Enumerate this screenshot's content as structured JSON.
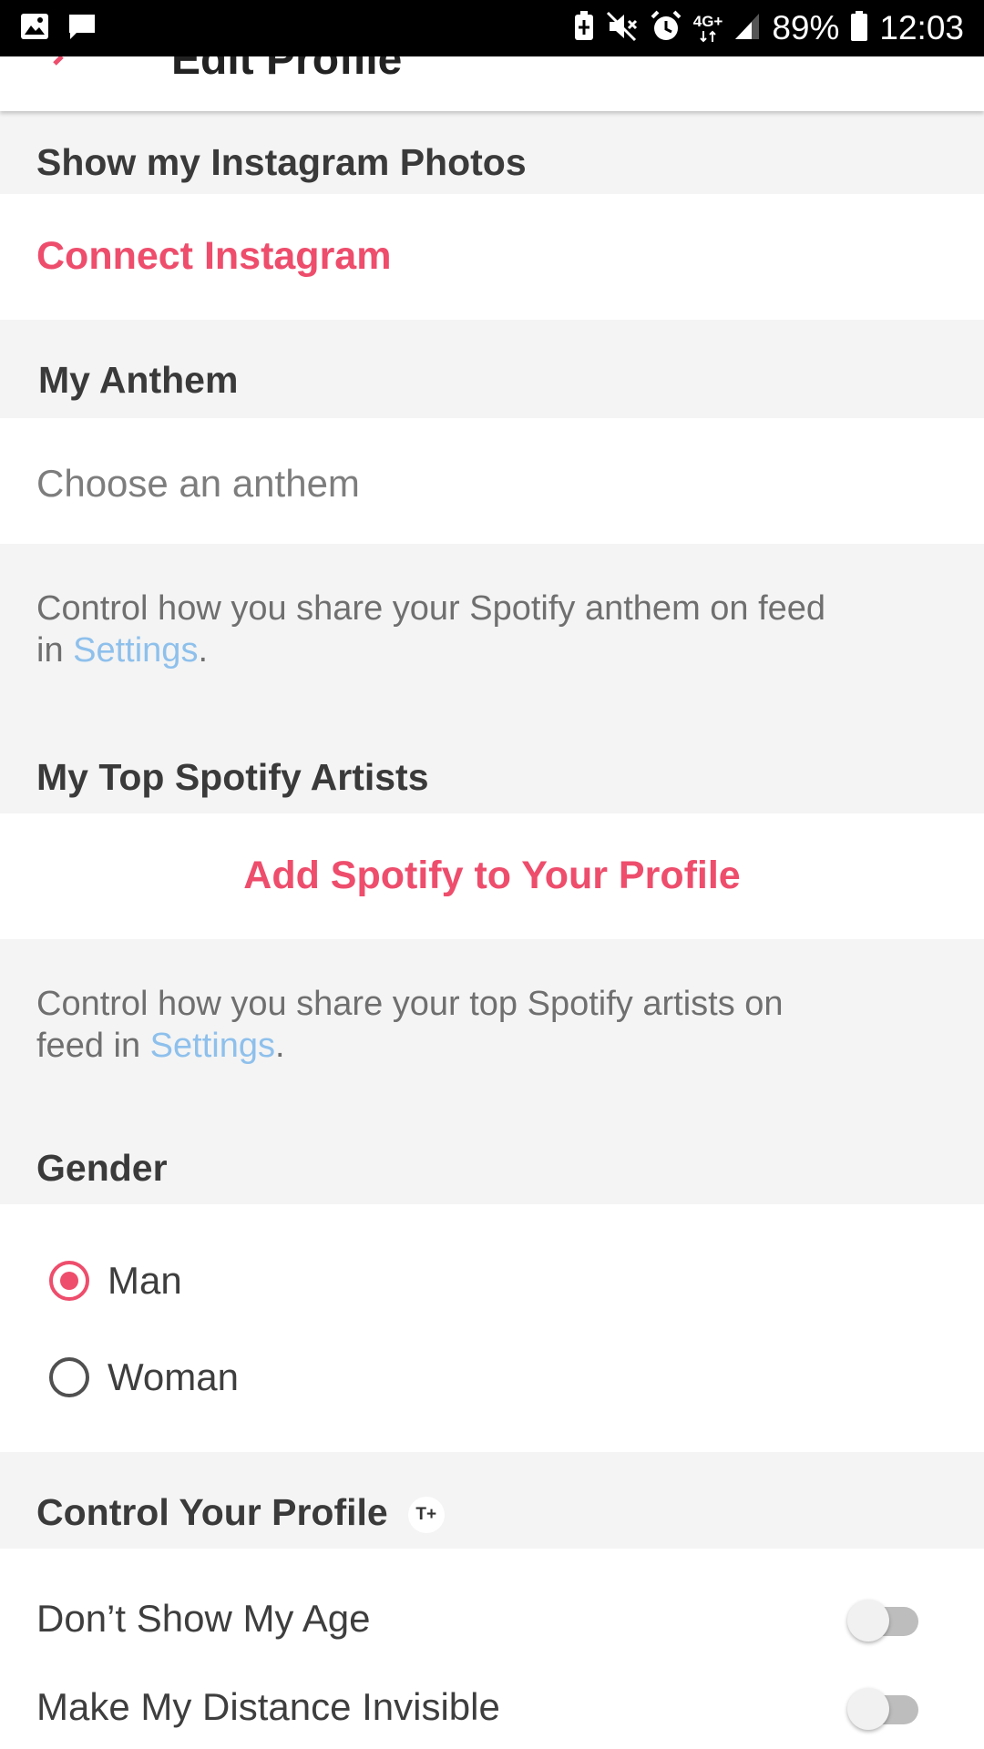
{
  "status_bar": {
    "network": "4G+",
    "battery": "89%",
    "time": "12:03",
    "icons": [
      "gallery-icon",
      "message-icon",
      "battery-saver-icon",
      "mute-icon",
      "alarm-icon",
      "signal-icon",
      "battery-icon"
    ]
  },
  "toolbar": {
    "title": "Edit Profile"
  },
  "instagram": {
    "header": "Show my Instagram Photos",
    "connect_label": "Connect Instagram"
  },
  "anthem": {
    "header": "My Anthem",
    "placeholder": "Choose an anthem",
    "desc_prefix": "Control how you share your Spotify anthem on feed in ",
    "desc_link": "Settings",
    "desc_suffix": "."
  },
  "spotify": {
    "header": "My Top Spotify Artists",
    "add_label": "Add Spotify to Your Profile",
    "desc_prefix": "Control how you share your top Spotify artists on feed in ",
    "desc_link": "Settings",
    "desc_suffix": "."
  },
  "gender": {
    "header": "Gender",
    "options": [
      {
        "label": "Man",
        "selected": true
      },
      {
        "label": "Woman",
        "selected": false
      }
    ]
  },
  "control": {
    "header": "Control Your Profile",
    "badge": "T+",
    "toggles": [
      {
        "label": "Don’t Show My Age",
        "on": false
      },
      {
        "label": "Make My Distance Invisible",
        "on": false
      }
    ]
  },
  "colors": {
    "accent": "#ee4d6c",
    "link": "#8ec0ec",
    "background": "#f4f4f4"
  }
}
